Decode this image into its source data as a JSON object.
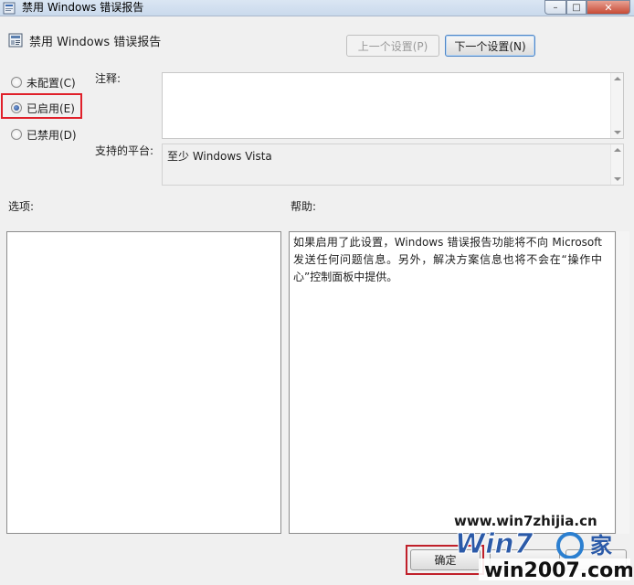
{
  "window": {
    "title": "禁用 Windows 错误报告",
    "controls": {
      "minimize": "–",
      "maximize": "□",
      "close": "✕"
    }
  },
  "header": {
    "policy_title": "禁用 Windows 错误报告",
    "prev_button": "上一个设置(P)",
    "next_button": "下一个设置(N)"
  },
  "state": {
    "options": [
      {
        "label": "未配置(C)",
        "checked": false
      },
      {
        "label": "已启用(E)",
        "checked": true
      },
      {
        "label": "已禁用(D)",
        "checked": false
      }
    ],
    "highlight_color": "#e0202a"
  },
  "comment": {
    "label": "注释:",
    "value": ""
  },
  "platform": {
    "label": "支持的平台:",
    "value": "至少 Windows Vista"
  },
  "options_pane": {
    "label": "选项:"
  },
  "help": {
    "label": "帮助:",
    "text": "如果启用了此设置，Windows 错误报告功能将不向 Microsoft 发送任何问题信息。另外，解决方案信息也将不会在“操作中心”控制面板中提供。"
  },
  "footer": {
    "ok_button": "确定",
    "cancel_button": "",
    "apply_button": ""
  },
  "watermark": {
    "url": "www.win7zhijia.cn",
    "logo_text": "win2007.com",
    "logo_mark": "Win7"
  },
  "icons": [
    "policy-icon",
    "radio-icon",
    "scroll-arrow-icon",
    "window-close-icon"
  ]
}
